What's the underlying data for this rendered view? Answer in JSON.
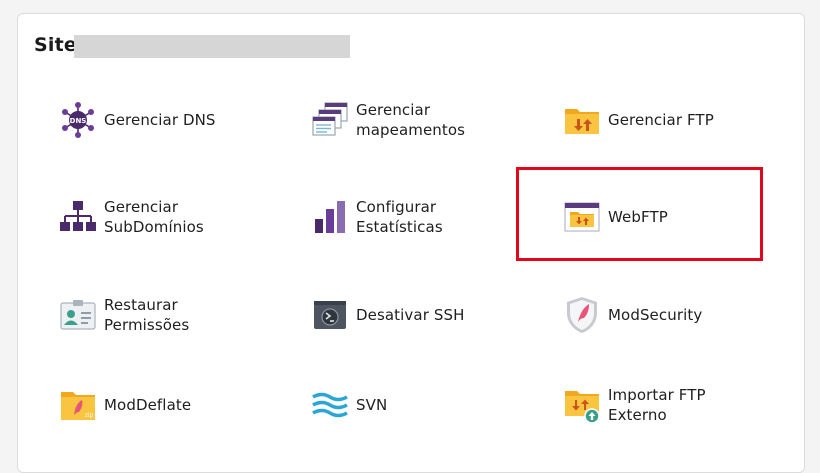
{
  "section": {
    "title": "Site"
  },
  "items": [
    {
      "label": "Gerenciar DNS",
      "icon": "dns-network-icon"
    },
    {
      "label": "Gerenciar\nmapeamentos",
      "icon": "mappings-icon"
    },
    {
      "label": "Gerenciar FTP",
      "icon": "ftp-folder-icon"
    },
    {
      "label": "Gerenciar\nSubDomínios",
      "icon": "subdomain-tree-icon"
    },
    {
      "label": "Configurar\nEstatísticas",
      "icon": "statistics-bars-icon"
    },
    {
      "label": "WebFTP",
      "icon": "webftp-window-icon"
    },
    {
      "label": "Restaurar\nPermissões",
      "icon": "id-card-icon"
    },
    {
      "label": "Desativar SSH",
      "icon": "terminal-icon"
    },
    {
      "label": "ModSecurity",
      "icon": "shield-icon"
    },
    {
      "label": "ModDeflate",
      "icon": "zip-folder-icon"
    },
    {
      "label": "SVN",
      "icon": "svn-waves-icon"
    },
    {
      "label": "Importar FTP\nExterno",
      "icon": "ftp-import-icon"
    }
  ],
  "colors": {
    "purple": "#4a2a6b",
    "folder": "#f7b733",
    "highlight": "#e2071b",
    "svn": "#2aa6d6"
  }
}
